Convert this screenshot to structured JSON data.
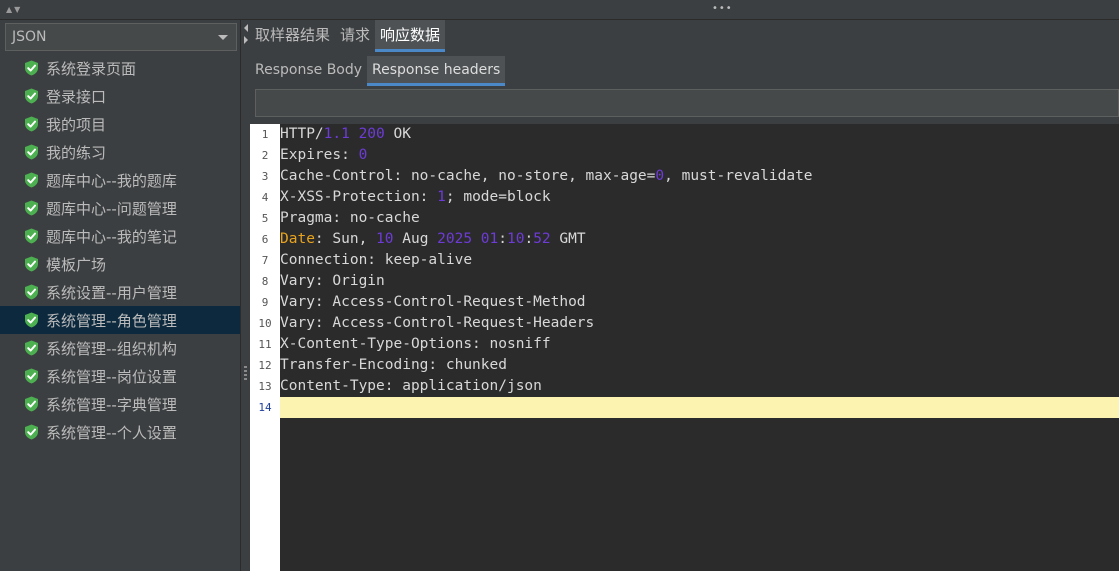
{
  "combo": {
    "value": "JSON",
    "icon": "chevron-down-icon"
  },
  "tree": [
    {
      "label": "系统登录页面",
      "icon": "shield-check-icon"
    },
    {
      "label": "登录接口",
      "icon": "shield-check-icon"
    },
    {
      "label": "我的项目",
      "icon": "shield-check-icon"
    },
    {
      "label": "我的练习",
      "icon": "shield-check-icon"
    },
    {
      "label": "题库中心--我的题库",
      "icon": "shield-check-icon"
    },
    {
      "label": "题库中心--问题管理",
      "icon": "shield-check-icon"
    },
    {
      "label": "题库中心--我的笔记",
      "icon": "shield-check-icon"
    },
    {
      "label": "模板广场",
      "icon": "shield-check-icon"
    },
    {
      "label": "系统设置--用户管理",
      "icon": "shield-check-icon"
    },
    {
      "label": "系统管理--角色管理",
      "icon": "shield-check-icon",
      "selected": true
    },
    {
      "label": "系统管理--组织机构",
      "icon": "shield-check-icon"
    },
    {
      "label": "系统管理--岗位设置",
      "icon": "shield-check-icon"
    },
    {
      "label": "系统管理--字典管理",
      "icon": "shield-check-icon"
    },
    {
      "label": "系统管理--个人设置",
      "icon": "shield-check-icon"
    }
  ],
  "tabs": [
    "取样器结果",
    "请求",
    "响应数据"
  ],
  "active_tab": "响应数据",
  "subtabs": [
    "Response Body",
    "Response headers"
  ],
  "active_subtab": "Response headers",
  "search": {
    "value": "",
    "placeholder": ""
  },
  "editor": {
    "current_line": 14,
    "lines": [
      [
        {
          "t": "HTTP"
        },
        {
          "t": "/"
        },
        {
          "t": "1.1 200",
          "c": "num"
        },
        {
          "t": " OK"
        }
      ],
      [
        {
          "t": "Expires"
        },
        {
          "t": ": "
        },
        {
          "t": "0",
          "c": "num"
        }
      ],
      [
        {
          "t": "Cache-Control: no-cache, no-store, max-age="
        },
        {
          "t": "0",
          "c": "num"
        },
        {
          "t": ", must-revalidate"
        }
      ],
      [
        {
          "t": "X-XSS-Protection: "
        },
        {
          "t": "1",
          "c": "num"
        },
        {
          "t": "; mode=block"
        }
      ],
      [
        {
          "t": "Pragma: no-cache"
        }
      ],
      [
        {
          "t": "Date",
          "c": "orange"
        },
        {
          "t": ": Sun, "
        },
        {
          "t": "10",
          "c": "num"
        },
        {
          "t": " Aug "
        },
        {
          "t": "2025 01",
          "c": "num"
        },
        {
          "t": ":"
        },
        {
          "t": "10",
          "c": "num"
        },
        {
          "t": ":"
        },
        {
          "t": "52",
          "c": "num"
        },
        {
          "t": " GMT"
        }
      ],
      [
        {
          "t": "Connection: keep-alive"
        }
      ],
      [
        {
          "t": "Vary: Origin"
        }
      ],
      [
        {
          "t": "Vary: Access-Control-Request-Method"
        }
      ],
      [
        {
          "t": "Vary: Access-Control-Request-Headers"
        }
      ],
      [
        {
          "t": "X-Content-Type-Options: nosniff"
        }
      ],
      [
        {
          "t": "Transfer-Encoding: chunked"
        }
      ],
      [
        {
          "t": "Content-Type: application/json"
        }
      ],
      [
        {
          "t": ""
        }
      ]
    ]
  },
  "colors": {
    "accent": "#4a88c7",
    "selected_row": "#0d293e",
    "shield": "#4caf50",
    "number": "#6d3bd6",
    "keyword": "#e8a31e",
    "current_line": "#fcf3b0"
  }
}
